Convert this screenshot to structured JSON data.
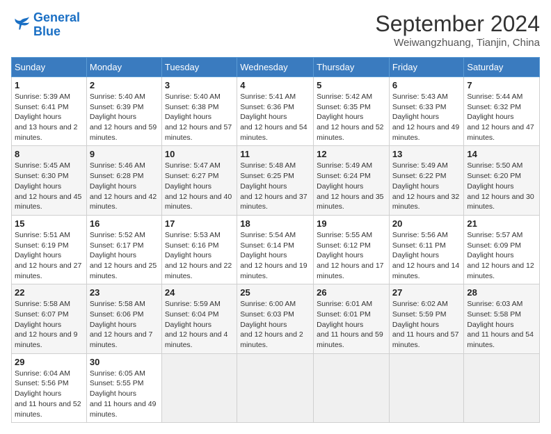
{
  "header": {
    "logo_line1": "General",
    "logo_line2": "Blue",
    "month": "September 2024",
    "location": "Weiwangzhuang, Tianjin, China"
  },
  "weekdays": [
    "Sunday",
    "Monday",
    "Tuesday",
    "Wednesday",
    "Thursday",
    "Friday",
    "Saturday"
  ],
  "weeks": [
    [
      {
        "day": "1",
        "rise": "5:39 AM",
        "set": "6:41 PM",
        "daylight": "13 hours and 2 minutes."
      },
      {
        "day": "2",
        "rise": "5:40 AM",
        "set": "6:39 PM",
        "daylight": "12 hours and 59 minutes."
      },
      {
        "day": "3",
        "rise": "5:40 AM",
        "set": "6:38 PM",
        "daylight": "12 hours and 57 minutes."
      },
      {
        "day": "4",
        "rise": "5:41 AM",
        "set": "6:36 PM",
        "daylight": "12 hours and 54 minutes."
      },
      {
        "day": "5",
        "rise": "5:42 AM",
        "set": "6:35 PM",
        "daylight": "12 hours and 52 minutes."
      },
      {
        "day": "6",
        "rise": "5:43 AM",
        "set": "6:33 PM",
        "daylight": "12 hours and 49 minutes."
      },
      {
        "day": "7",
        "rise": "5:44 AM",
        "set": "6:32 PM",
        "daylight": "12 hours and 47 minutes."
      }
    ],
    [
      {
        "day": "8",
        "rise": "5:45 AM",
        "set": "6:30 PM",
        "daylight": "12 hours and 45 minutes."
      },
      {
        "day": "9",
        "rise": "5:46 AM",
        "set": "6:28 PM",
        "daylight": "12 hours and 42 minutes."
      },
      {
        "day": "10",
        "rise": "5:47 AM",
        "set": "6:27 PM",
        "daylight": "12 hours and 40 minutes."
      },
      {
        "day": "11",
        "rise": "5:48 AM",
        "set": "6:25 PM",
        "daylight": "12 hours and 37 minutes."
      },
      {
        "day": "12",
        "rise": "5:49 AM",
        "set": "6:24 PM",
        "daylight": "12 hours and 35 minutes."
      },
      {
        "day": "13",
        "rise": "5:49 AM",
        "set": "6:22 PM",
        "daylight": "12 hours and 32 minutes."
      },
      {
        "day": "14",
        "rise": "5:50 AM",
        "set": "6:20 PM",
        "daylight": "12 hours and 30 minutes."
      }
    ],
    [
      {
        "day": "15",
        "rise": "5:51 AM",
        "set": "6:19 PM",
        "daylight": "12 hours and 27 minutes."
      },
      {
        "day": "16",
        "rise": "5:52 AM",
        "set": "6:17 PM",
        "daylight": "12 hours and 25 minutes."
      },
      {
        "day": "17",
        "rise": "5:53 AM",
        "set": "6:16 PM",
        "daylight": "12 hours and 22 minutes."
      },
      {
        "day": "18",
        "rise": "5:54 AM",
        "set": "6:14 PM",
        "daylight": "12 hours and 19 minutes."
      },
      {
        "day": "19",
        "rise": "5:55 AM",
        "set": "6:12 PM",
        "daylight": "12 hours and 17 minutes."
      },
      {
        "day": "20",
        "rise": "5:56 AM",
        "set": "6:11 PM",
        "daylight": "12 hours and 14 minutes."
      },
      {
        "day": "21",
        "rise": "5:57 AM",
        "set": "6:09 PM",
        "daylight": "12 hours and 12 minutes."
      }
    ],
    [
      {
        "day": "22",
        "rise": "5:58 AM",
        "set": "6:07 PM",
        "daylight": "12 hours and 9 minutes."
      },
      {
        "day": "23",
        "rise": "5:58 AM",
        "set": "6:06 PM",
        "daylight": "12 hours and 7 minutes."
      },
      {
        "day": "24",
        "rise": "5:59 AM",
        "set": "6:04 PM",
        "daylight": "12 hours and 4 minutes."
      },
      {
        "day": "25",
        "rise": "6:00 AM",
        "set": "6:03 PM",
        "daylight": "12 hours and 2 minutes."
      },
      {
        "day": "26",
        "rise": "6:01 AM",
        "set": "6:01 PM",
        "daylight": "11 hours and 59 minutes."
      },
      {
        "day": "27",
        "rise": "6:02 AM",
        "set": "5:59 PM",
        "daylight": "11 hours and 57 minutes."
      },
      {
        "day": "28",
        "rise": "6:03 AM",
        "set": "5:58 PM",
        "daylight": "11 hours and 54 minutes."
      }
    ],
    [
      {
        "day": "29",
        "rise": "6:04 AM",
        "set": "5:56 PM",
        "daylight": "11 hours and 52 minutes."
      },
      {
        "day": "30",
        "rise": "6:05 AM",
        "set": "5:55 PM",
        "daylight": "11 hours and 49 minutes."
      },
      null,
      null,
      null,
      null,
      null
    ]
  ]
}
